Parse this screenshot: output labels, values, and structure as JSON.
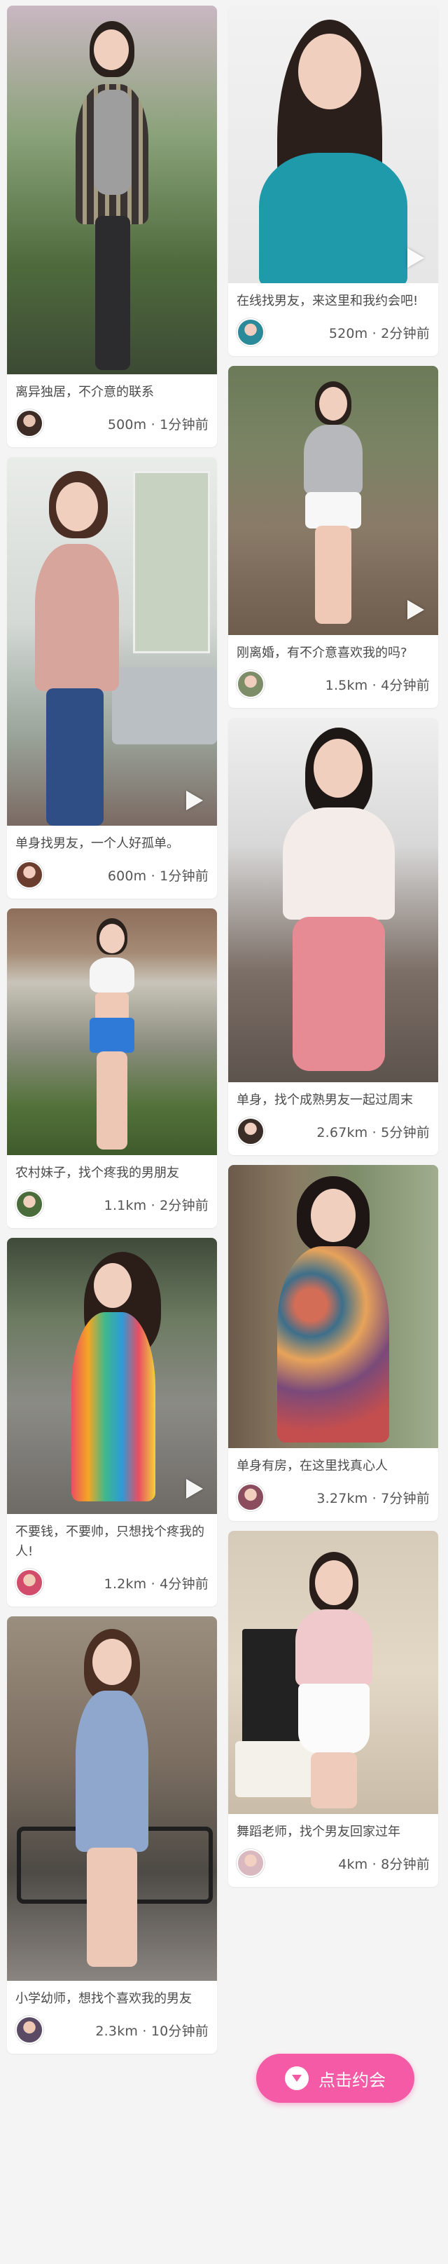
{
  "cards": [
    {
      "caption": "离异独居，不介意的联系",
      "distance": "500m · 1分钟前",
      "video": false
    },
    {
      "caption": "在线找男友，来这里和我约会吧!",
      "distance": "520m · 2分钟前",
      "video": true
    },
    {
      "caption": "刚离婚，有不介意喜欢我的吗?",
      "distance": "1.5km · 4分钟前",
      "video": true
    },
    {
      "caption": "单身找男友，一个人好孤单。",
      "distance": "600m · 1分钟前",
      "video": true
    },
    {
      "caption": "单身，找个成熟男友一起过周末",
      "distance": "2.67km · 5分钟前",
      "video": false
    },
    {
      "caption": "农村妹子，找个疼我的男朋友",
      "distance": "1.1km · 2分钟前",
      "video": false
    },
    {
      "caption": "单身有房，在这里找真心人",
      "distance": "3.27km · 7分钟前",
      "video": false
    },
    {
      "caption": "不要钱，不要帅，只想找个疼我的人!",
      "distance": "1.2km · 4分钟前",
      "video": true
    },
    {
      "caption": "舞蹈老师，找个男友回家过年",
      "distance": "4km · 8分钟前",
      "video": false
    },
    {
      "caption": "小学幼师，想找个喜欢我的男友",
      "distance": "2.3km · 10分钟前",
      "video": false
    }
  ],
  "cta": {
    "label": "点击约会",
    "icon": "chevron-down-icon"
  },
  "colors": {
    "accent": "#f55aa6",
    "background": "#f4f4f4"
  }
}
